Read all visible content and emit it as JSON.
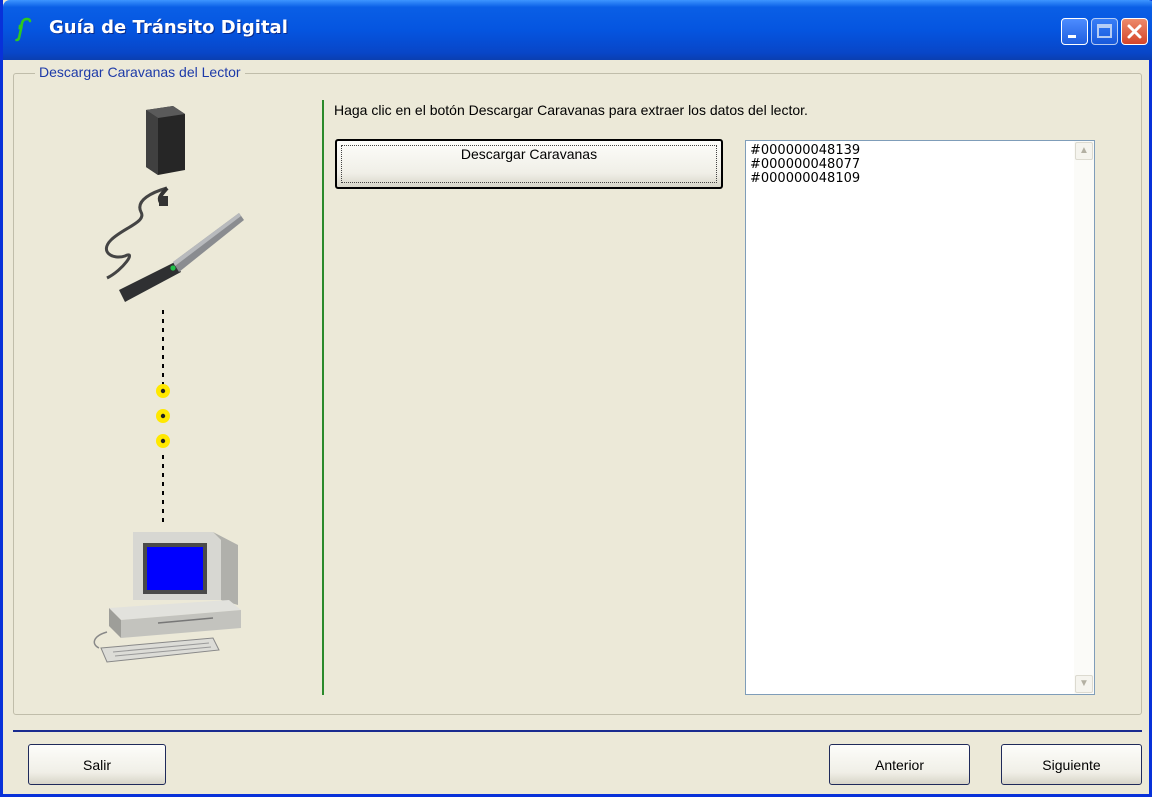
{
  "window": {
    "title": "Guía de Tránsito Digital",
    "title_color": "#ffffff",
    "titlebar_color": "#0555e0",
    "controls": [
      "minimize-icon",
      "maximize-icon",
      "close-icon"
    ]
  },
  "group": {
    "legend": "Descargar Caravanas del Lector"
  },
  "illustration": {
    "icons": [
      "reader-box-icon",
      "rfid-wand-icon",
      "dotted-connection-line",
      "computer-icon"
    ]
  },
  "main": {
    "instruction": "Haga clic en el botón Descargar Caravanas para extraer los datos del lector.",
    "download_button_label": "Descargar Caravanas",
    "tags": [
      "#000000048139",
      "#000000048077",
      "#000000048109"
    ]
  },
  "footer": {
    "exit_label": "Salir",
    "prev_label": "Anterior",
    "next_label": "Siguiente"
  },
  "colors": {
    "background": "#ece9d8",
    "divider_green": "#2b8a2b",
    "footer_line": "#1a2b8f",
    "dots_yellow": "#ffe800"
  }
}
